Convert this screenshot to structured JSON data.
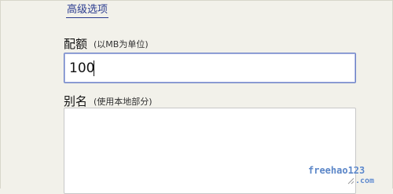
{
  "advanced_tab": {
    "label": "高级选项"
  },
  "quota": {
    "label": "配额",
    "hint": "(以MB为单位)",
    "value": "100"
  },
  "alias": {
    "label": "别名",
    "hint": "(使用本地部分)",
    "value": ""
  },
  "watermark": {
    "text": "freehao123",
    "subtext": ".com"
  },
  "colors": {
    "background": "#f2f1ea",
    "link": "#2a3b8f",
    "input_focus_border": "#6b80c5"
  }
}
